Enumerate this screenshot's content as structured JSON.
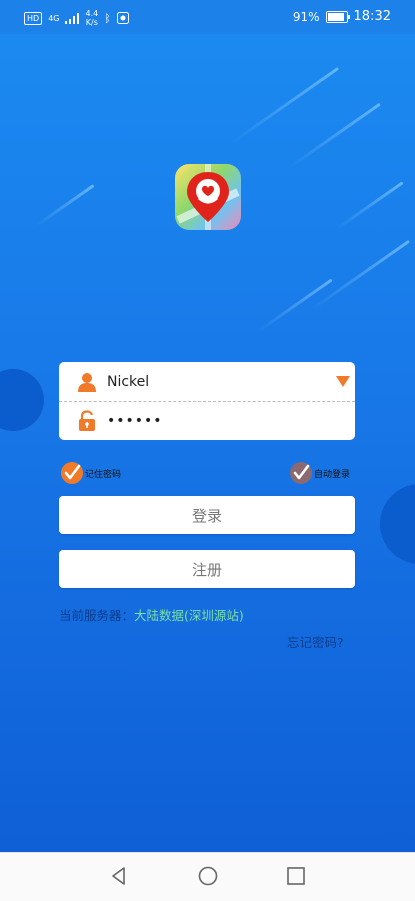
{
  "status_bar": {
    "hd": "HD",
    "network": "4G",
    "speed_value": "4.4",
    "speed_unit": "K/s",
    "battery": "91%",
    "time": "18:32"
  },
  "login": {
    "username": "Nickel",
    "password_mask": "••••••"
  },
  "options": {
    "remember_password": "记住密码",
    "auto_login": "自动登录"
  },
  "buttons": {
    "login": "登录",
    "register": "注册"
  },
  "server": {
    "label": "当前服务器：",
    "value": "大陆数据(深圳源站)"
  },
  "forgot_password": "忘记密码?",
  "colors": {
    "accent": "#f07a2a",
    "server_value": "#7be0a1",
    "label_text": "#0c3e8f"
  },
  "icons": {
    "user": "user-icon",
    "password": "lock-icon",
    "dropdown": "triangle-down-icon",
    "checked": "checkmark-icon"
  }
}
